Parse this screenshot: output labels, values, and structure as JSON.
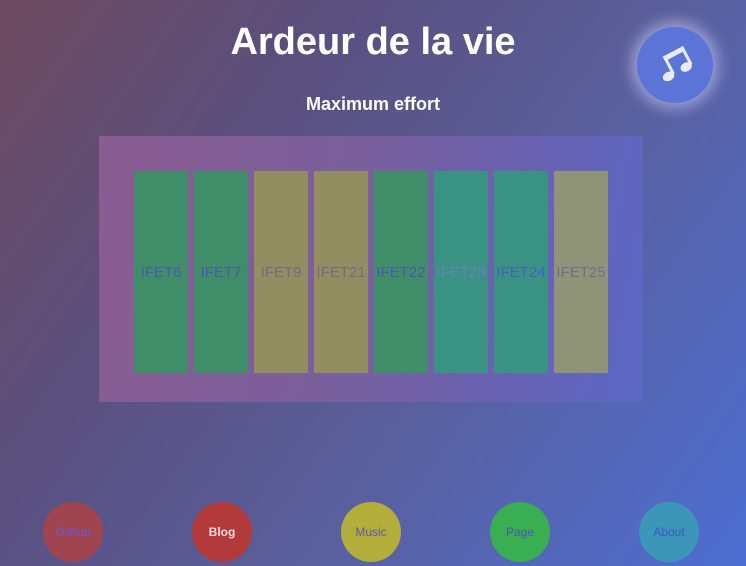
{
  "header": {
    "title": "Ardeur de la vie",
    "subtitle": "Maximum effort"
  },
  "music_toggle": {
    "icon": "music-note-icon"
  },
  "cards": [
    {
      "label": "IFET6",
      "color": "#3f8d69"
    },
    {
      "label": "IFET7",
      "color": "#3f8d69"
    },
    {
      "label": "IFET9",
      "color": "#938d62"
    },
    {
      "label": "IFET21",
      "color": "#938d62"
    },
    {
      "label": "IFET22",
      "color": "#3f8d69"
    },
    {
      "label": "IFET23",
      "color": "#3a9282"
    },
    {
      "label": "IFET24",
      "color": "#3a9282"
    },
    {
      "label": "IFET25",
      "color": "#8f9378"
    }
  ],
  "footer": {
    "links": [
      {
        "label": "Github",
        "color": "#a0444f",
        "text_color": "#6a5ad0"
      },
      {
        "label": "Blog",
        "color": "#b23a3a",
        "text_color": "#f3d9d9"
      },
      {
        "label": "Music",
        "color": "#b3ad3b",
        "text_color": "#5a5aa8"
      },
      {
        "label": "Page",
        "color": "#3aae52",
        "text_color": "#4d57b0"
      },
      {
        "label": "About",
        "color": "#3b96b8",
        "text_color": "#3d55c8"
      }
    ]
  }
}
